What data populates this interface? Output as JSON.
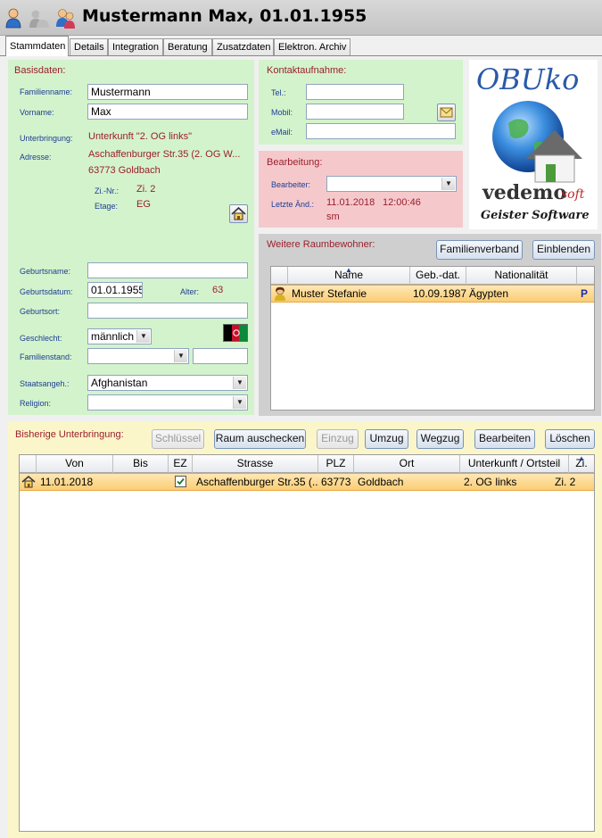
{
  "window": {
    "title": "Mustermann Max, 01.01.1955"
  },
  "tabs": [
    "Stammdaten",
    "Details",
    "Integration",
    "Beratung",
    "Zusatzdaten",
    "Elektron. Archiv"
  ],
  "basis": {
    "title": "Basisdaten:",
    "familienname_label": "Familienname:",
    "familienname": "Mustermann",
    "vorname_label": "Vorname:",
    "vorname": "Max",
    "unterbringung_label": "Unterbringung:",
    "unterbringung": "Unterkunft  \"2. OG links\"",
    "adresse_label": "Adresse:",
    "adresse_line1": "Aschaffenburger Str.35 (2. OG W...",
    "adresse_line2": "63773  Goldbach",
    "zinr_label": "Zi.-Nr.:",
    "zinr": "Zi. 2",
    "etage_label": "Etage:",
    "etage": "EG",
    "geburtsname_label": "Geburtsname:",
    "geburtsname": "",
    "geburtsdatum_label": "Geburtsdatum:",
    "geburtsdatum": "01.01.1955",
    "alter_label": "Alter:",
    "alter": "63",
    "geburtsort_label": "Geburtsort:",
    "geburtsort": "",
    "geschlecht_label": "Geschlecht:",
    "geschlecht": "männlich",
    "familienstand_label": "Familienstand:",
    "familienstand": "",
    "staatsangeh_label": "Staatsangeh.:",
    "staatsangeh": "Afghanistan",
    "religion_label": "Religion:",
    "religion": ""
  },
  "kontakt": {
    "title": "Kontaktaufnahme:",
    "tel_label": "Tel.:",
    "tel": "",
    "mobil_label": "Mobil:",
    "mobil": "",
    "email_label": "eMail:",
    "email": ""
  },
  "bearbeitung": {
    "title": "Bearbeitung:",
    "bearbeiter_label": "Bearbeiter:",
    "bearbeiter": "",
    "letzte_label": "Letzte Änd.:",
    "letzte_date": "11.01.2018",
    "letzte_time": "12:00:46",
    "letzte_user": "sm"
  },
  "logo": {
    "obuko": "OBUko",
    "vedemo": "vedemo",
    "vedemo_suffix": "soft",
    "geister": "Geister Software"
  },
  "raum": {
    "title": "Weitere Raumbewohner:",
    "btn_familienverband": "Familienverband",
    "btn_einblenden": "Einblenden",
    "columns": [
      "Name",
      "Geb.-dat.",
      "Nationalität"
    ],
    "rows": [
      {
        "name": "Muster Stefanie",
        "gebdat": "10.09.1987",
        "nat": "Ägypten",
        "flag": "P"
      }
    ]
  },
  "unterbringung": {
    "title": "Bisherige Unterbringung:",
    "buttons": {
      "schluessel": "Schlüssel",
      "auschecken": "Raum auschecken",
      "einzug": "Einzug",
      "umzug": "Umzug",
      "wegzug": "Wegzug",
      "bearbeiten": "Bearbeiten",
      "loeschen": "Löschen"
    },
    "columns": [
      "Von",
      "Bis",
      "EZ",
      "Strasse",
      "PLZ",
      "Ort",
      "Unterkunft / Ortsteil",
      "Zi."
    ],
    "rows": [
      {
        "von": "11.01.2018",
        "bis": "",
        "ez": true,
        "strasse": "Aschaffenburger Str.35 (...",
        "plz": "63773",
        "ort": "Goldbach",
        "unterkunft": "2. OG links",
        "zi": "Zi. 2"
      }
    ]
  },
  "colors": {
    "label_blue": "#1f3d94",
    "value_red": "#9a1f2e",
    "panel_green": "#d3f3cc",
    "panel_red": "#f5c9cc",
    "panel_yellow": "#fbf6c9",
    "row_highlight": "#fbcd74"
  }
}
